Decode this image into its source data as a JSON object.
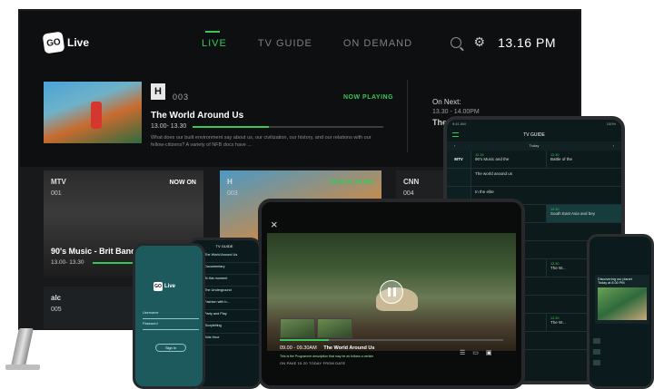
{
  "tv": {
    "logo": {
      "mark": "GO",
      "text": "Live"
    },
    "nav": [
      {
        "label": "LIVE",
        "active": true
      },
      {
        "label": "TV GUIDE",
        "active": false
      },
      {
        "label": "ON DEMAND",
        "active": false
      }
    ],
    "clock": "13.16 PM",
    "hero": {
      "channel_logo": "H",
      "channel_code": "003",
      "status": "NOW PLAYING",
      "title": "The World Around Us",
      "time": "13.00- 13.30",
      "progress": 0.4,
      "description": "What does our built environment say about us, our civilization, our history, and our relations with our fellow-citizens? A variety of NFB docs have ..."
    },
    "next": {
      "label": "On Next:",
      "time": "13.30 - 14.00PM",
      "title": "The Frontier Bewarde"
    },
    "tiles": [
      {
        "logo": "MTV",
        "code": "001",
        "badge": "NOW ON",
        "title": "90's Music - Brit Bands",
        "time": "13.00- 13.30"
      },
      {
        "logo": "H",
        "code": "003",
        "badge": "NOW PLAYING"
      },
      {
        "logo": "CNN",
        "code": "004"
      },
      {
        "logo": "alc",
        "code": "005"
      }
    ],
    "colors": {
      "accent": "#37c85a",
      "background": "#0d0f10"
    }
  },
  "tablet_right": {
    "status_left": "9:41 AM",
    "status_right": "100%",
    "title": "TV GUIDE",
    "date": "Today",
    "guide": [
      {
        "channel": "MTV",
        "programs": [
          {
            "time": "12.15",
            "title": "90's Music and the"
          },
          {
            "time": "12.30",
            "title": "Battle of the"
          }
        ]
      },
      {
        "channel": "",
        "programs": [
          {
            "time": "",
            "title": "The world around us"
          }
        ]
      },
      {
        "channel": "",
        "programs": [
          {
            "time": "",
            "title": "In the elite"
          }
        ]
      },
      {
        "channel": "",
        "programs": [
          {
            "time": "",
            "title": "Down Under"
          },
          {
            "time": "12.30",
            "title": "South East Asia and bey"
          }
        ]
      },
      {
        "channel": "",
        "programs": [
          {
            "time": "",
            "title": "Hunters"
          }
        ]
      },
      {
        "channel": "",
        "programs": [
          {
            "time": "",
            "title": "At this moment"
          }
        ]
      },
      {
        "channel": "",
        "programs": [
          {
            "time": "",
            "title": "Nole Vision"
          },
          {
            "time": "12.30",
            "title": "The W..."
          }
        ]
      },
      {
        "channel": "",
        "programs": [
          {
            "time": "",
            "title": "Fashion with b..."
          }
        ]
      },
      {
        "channel": "",
        "programs": [
          {
            "time": "",
            "title": "Party And Play Music"
          }
        ]
      },
      {
        "channel": "",
        "programs": [
          {
            "time": "",
            "title": "Party And Play"
          },
          {
            "time": "12.30",
            "title": "The W..."
          }
        ]
      },
      {
        "channel": "",
        "programs": [
          {
            "time": "",
            "title": "Fashion with b..."
          }
        ]
      }
    ]
  },
  "phone_right": {
    "card_title": "Discovering our planet",
    "card_sub": "Today at 8.00 PM"
  },
  "tablet_center": {
    "close": "×",
    "time": "09.00 - 09.30AM",
    "title": "The World Around Us",
    "description": "This is the Programme description that may be as follows a certain",
    "meta": "ON PAVE   15.20   TODAY   FROM DATE",
    "progress": 0.22,
    "icons": [
      "list-icon",
      "cast-icon",
      "pip-icon"
    ]
  },
  "phone_mid": {
    "title": "TV GUIDE",
    "rows": [
      "The World Around Us",
      "Documentary",
      "At this moment",
      "The Underground",
      "Fashion with b...",
      "Party and Play",
      "Storytelling",
      "Kids Hour"
    ]
  },
  "phone_left": {
    "logo": {
      "mark": "GO",
      "text": "Live"
    },
    "username_placeholder": "Username",
    "password_placeholder": "Password",
    "signin": "Sign In"
  }
}
